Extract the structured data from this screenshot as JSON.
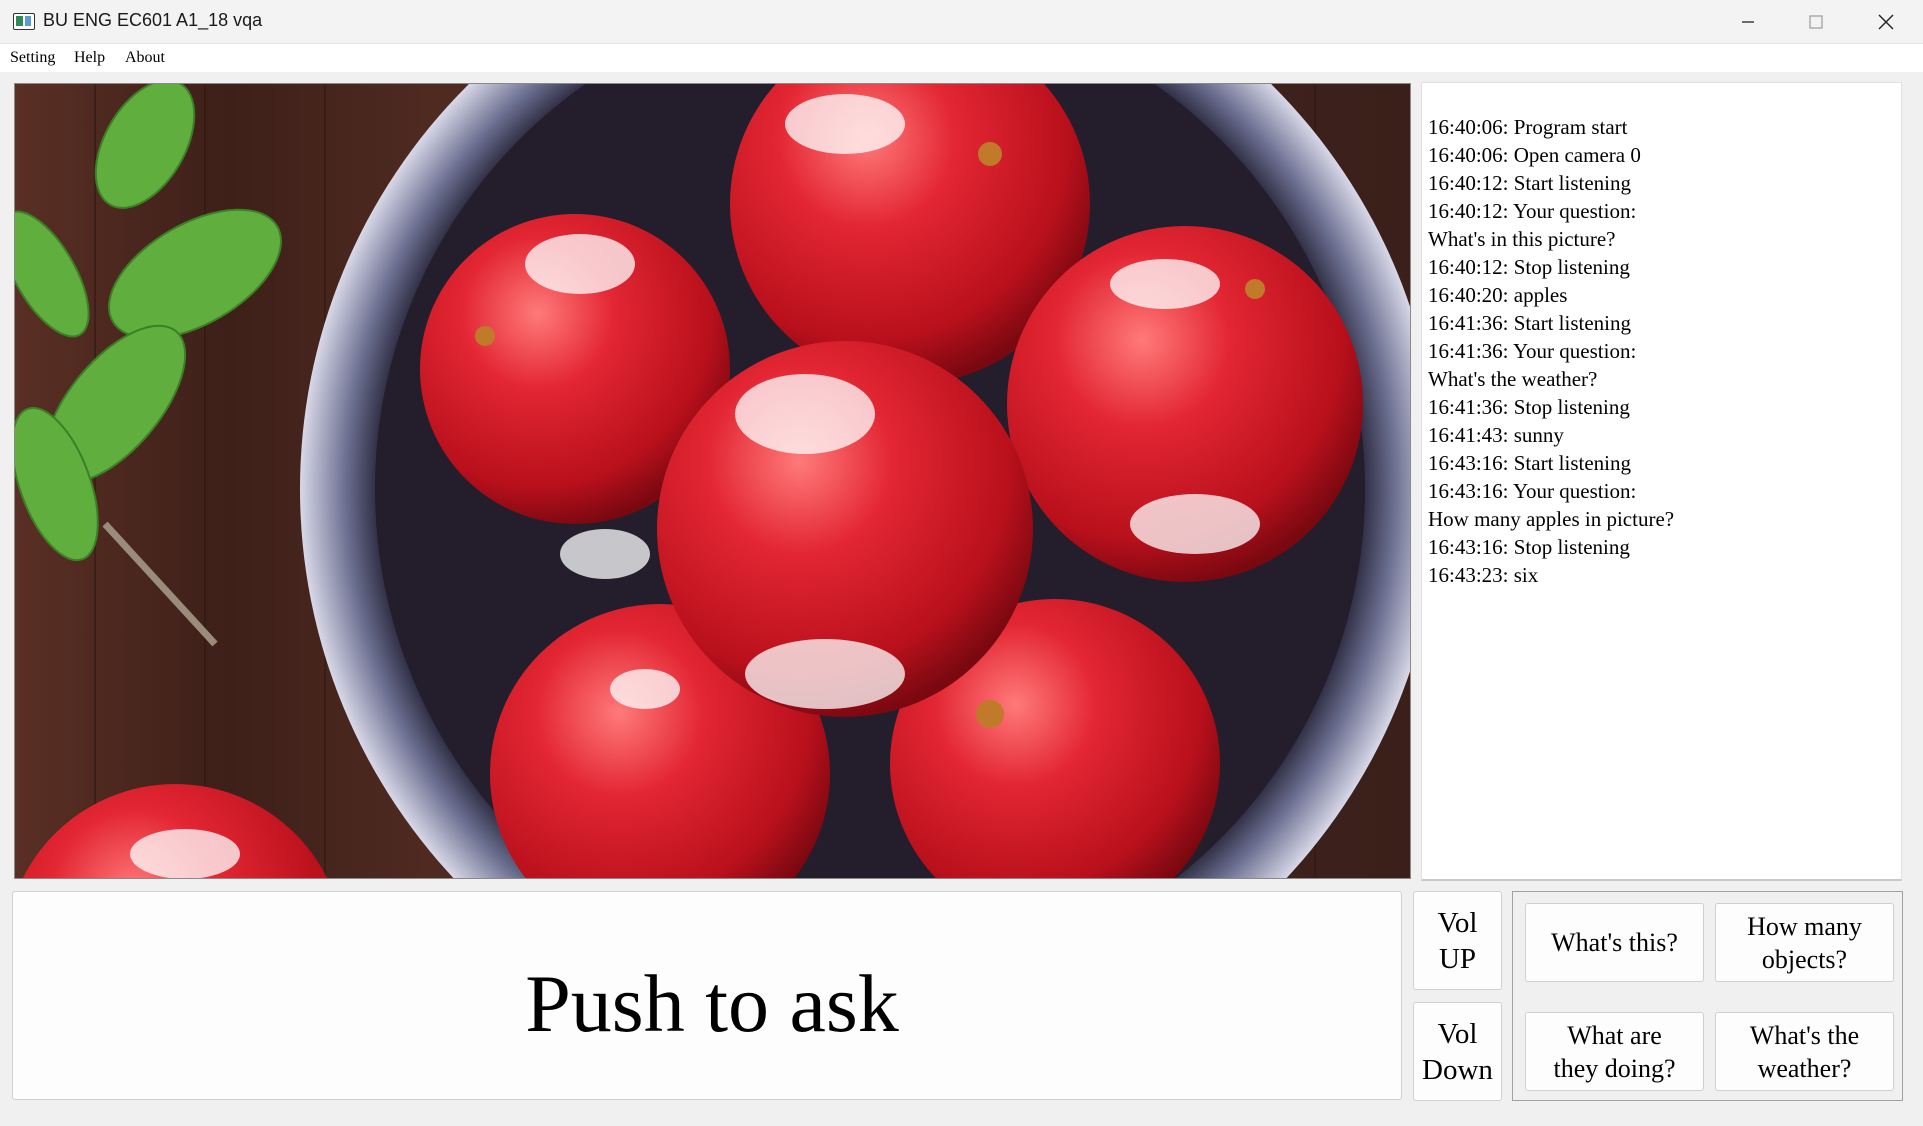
{
  "window": {
    "title": "BU ENG EC601 A1_18 vqa",
    "icon": "app-window-icon",
    "controls": [
      "minimize-icon",
      "maximize-icon",
      "close-icon"
    ]
  },
  "menu": {
    "setting": "Setting",
    "help": "Help",
    "about": "About"
  },
  "camera": {
    "subject": "Six red apples in a white bowl on a wooden table"
  },
  "log": [
    "16:40:06: Program start",
    "16:40:06: Open camera 0",
    "16:40:12: Start listening",
    "16:40:12: Your question:",
    "What's in this picture?",
    "16:40:12: Stop listening",
    "16:40:20: apples",
    "16:41:36: Start listening",
    "16:41:36: Your question:",
    "What's the weather?",
    "16:41:36: Stop listening",
    "16:41:43: sunny",
    "16:43:16: Start listening",
    "16:43:16: Your question:",
    "How many apples in picture?",
    "16:43:16: Stop listening",
    "16:43:23: six"
  ],
  "controls": {
    "push_to_ask": "Push to ask",
    "vol_up": "Vol\nUP",
    "vol_down": "Vol\nDown",
    "quick_questions": [
      "What's this?",
      "How many\nobjects?",
      "What are\nthey doing?",
      "What's the\nweather?"
    ]
  },
  "colors": {
    "window_bg": "#f0f0f0",
    "button_bg": "#fdfdfd",
    "apple_red": "#d81a24",
    "table_wood": "#4a2a22"
  }
}
